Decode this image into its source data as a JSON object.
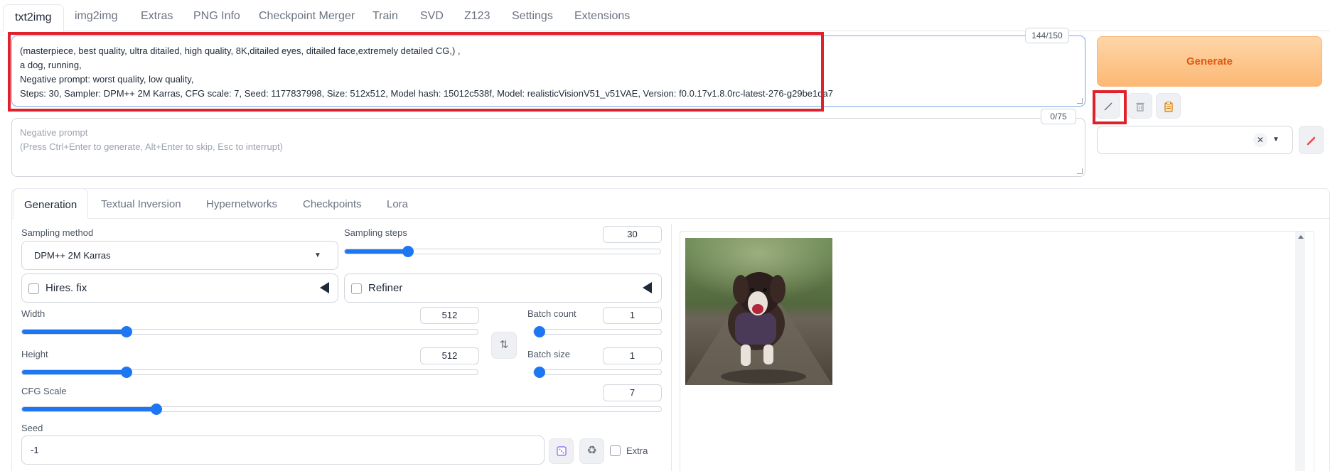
{
  "top_tabs": [
    "txt2img",
    "img2img",
    "Extras",
    "PNG Info",
    "Checkpoint Merger",
    "Train",
    "SVD",
    "Z123",
    "Settings",
    "Extensions"
  ],
  "prompt": {
    "lines": [
      "(masterpiece, best quality, ultra ditailed, high quality, 8K,ditailed eyes, ditailed face,extremely detailed CG,) ,",
      "a dog, running,",
      "Negative prompt: worst quality, low quality,",
      "Steps: 30, Sampler: DPM++ 2M Karras, CFG scale: 7, Seed: 1177837998, Size: 512x512, Model hash: 15012c538f, Model: realisticVisionV51_v51VAE, Version: f0.0.17v1.8.0rc-latest-276-g29be1da7"
    ],
    "token_count": "144/150"
  },
  "negative_prompt": {
    "placeholder_line1": "Negative prompt",
    "placeholder_line2": "(Press Ctrl+Enter to generate, Alt+Enter to skip, Esc to interrupt)",
    "token_count": "0/75"
  },
  "generate_label": "Generate",
  "tool_icons": [
    "read-params-icon",
    "trash-icon",
    "clipboard-icon"
  ],
  "sub_tabs": [
    "Generation",
    "Textual Inversion",
    "Hypernetworks",
    "Checkpoints",
    "Lora"
  ],
  "params": {
    "sampling_method_label": "Sampling method",
    "sampling_method": "DPM++ 2M Karras",
    "sampling_steps_label": "Sampling steps",
    "sampling_steps": "30",
    "hires_fix_label": "Hires. fix",
    "refiner_label": "Refiner",
    "width_label": "Width",
    "width": "512",
    "height_label": "Height",
    "height": "512",
    "batch_count_label": "Batch count",
    "batch_count": "1",
    "batch_size_label": "Batch size",
    "batch_size": "1",
    "cfg_label": "CFG Scale",
    "cfg": "7",
    "seed_label": "Seed",
    "seed": "-1",
    "extra_label": "Extra"
  },
  "slider_levels": {
    "sampling_steps": 0.2,
    "width": 0.23,
    "height": 0.23,
    "batch_count": 0.0,
    "batch_size": 0.0,
    "cfg": 0.21
  },
  "colors": {
    "accent": "#1d77f2",
    "generate_text": "#e05a14",
    "highlight_box": "#e0212b"
  }
}
